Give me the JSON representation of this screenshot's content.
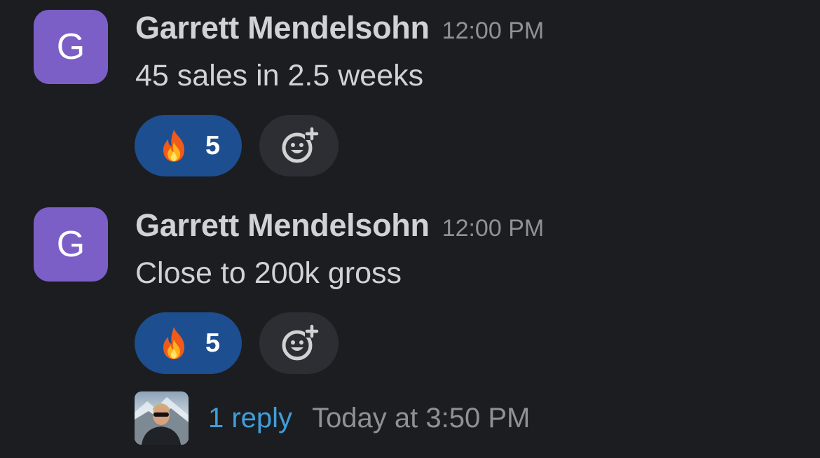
{
  "messages": [
    {
      "avatar_letter": "G",
      "author": "Garrett Mendelsohn",
      "time": "12:00 PM",
      "text": "45 sales in 2.5 weeks",
      "reaction": {
        "emoji": "fire-icon",
        "count": "5"
      }
    },
    {
      "avatar_letter": "G",
      "author": "Garrett Mendelsohn",
      "time": "12:00 PM",
      "text": "Close to 200k gross",
      "reaction": {
        "emoji": "fire-icon",
        "count": "5"
      }
    }
  ],
  "thread": {
    "reply_count": "1 reply",
    "last_reply": "Today at 3:50 PM"
  },
  "colors": {
    "background": "#1b1d21",
    "avatar": "#7b5fc6",
    "reaction_active": "#1d4e8f",
    "link": "#3f9fd9"
  }
}
